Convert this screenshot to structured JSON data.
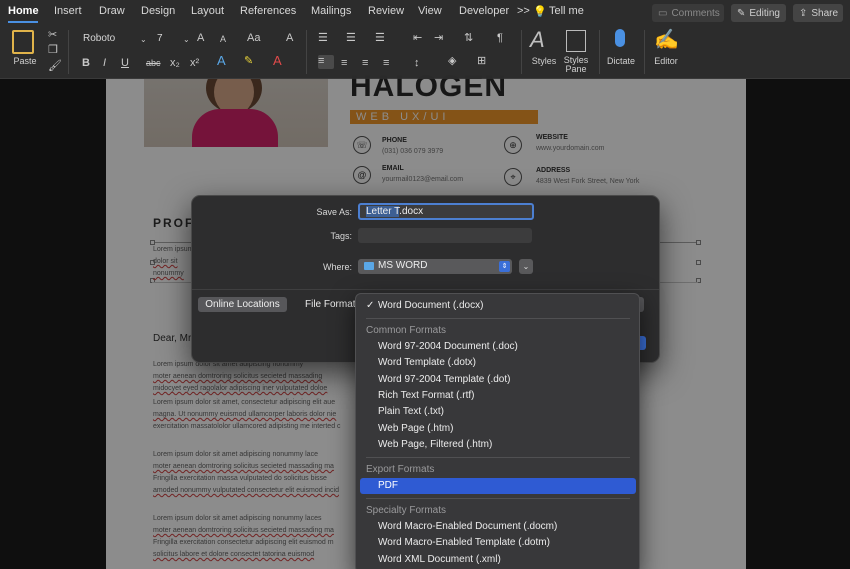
{
  "ribbon": {
    "tabs": [
      "Home",
      "Insert",
      "Draw",
      "Design",
      "Layout",
      "References",
      "Mailings",
      "Review",
      "View",
      "Developer"
    ],
    "more_glyph": ">>",
    "tell_me": "Tell me",
    "comments": "Comments",
    "editing": "Editing",
    "share": "Share",
    "paste_label": "Paste",
    "font_name": "Roboto",
    "font_size": "7",
    "styles_label": "Styles",
    "styles_pane_label": "Styles Pane",
    "dictate_label": "Dictate",
    "editor_label": "Editor",
    "bold": "B",
    "italic": "I",
    "underline": "U",
    "strike": "abc",
    "subscript": "x₂",
    "superscript": "x²",
    "grow_font": "A",
    "shrink_font": "A",
    "change_case": "Aa",
    "clear_format": "A",
    "pilcrow": "¶"
  },
  "document": {
    "name": "HALOGEN",
    "role": "WEB UX/UI DESIGNER",
    "contacts": [
      {
        "label": "PHONE",
        "value": "(031) 036 079 3979"
      },
      {
        "label": "WEBSITE",
        "value": "www.yourdomain.com"
      },
      {
        "label": "EMAIL",
        "value": "yourmail0123@email.com"
      },
      {
        "label": "ADDRESS",
        "value": "4839 West Fork Street, New York"
      }
    ],
    "profile_heading": "PROF",
    "profile_lines": [
      "Lorem ipsum",
      "dolor sit",
      "nonummy"
    ],
    "greeting": "Dear, Mr",
    "paragraph1": [
      "Lorem ipsum dolor sit amet adipiscing nonummy",
      "moter aenean domtroring solicitus secieted massading",
      "midocyet eyed ragolalor adipiscing iner vulputated doloe"
    ],
    "paragraph2": [
      "Lorem ipsum dolor sit amet, consectetur adipiscing elit aue",
      "magna. Ut nonummy euismod ullamcorper laboris dolor nie",
      "exercitation massatololor ullamcored adipisting me interted c"
    ],
    "paragraph3": [
      "Lorem ipsum dolor sit amet adipiscing nonummy lace",
      "moter aenean domtroring solicitus secieted massading ma",
      "Fringilla exercitation massa vulputated do solicitus bisse",
      "amoded nonummy vulputated consectetur elit euismod incid"
    ],
    "paragraph4": [
      "Lorem ipsum dolor sit amet adipiscing nonummy laces",
      "moter aenean domtroring solicitus secieted massading ma",
      "Fringilla exercitation consectetur adipiscing elit euismod m",
      "solicitus labore et dolore consectet tatorina euismod"
    ]
  },
  "save_dialog": {
    "save_as_label": "Save As:",
    "filename_selected": "Letter T",
    "filename_ext": ".docx",
    "tags_label": "Tags:",
    "tags_value": "",
    "where_label": "Where:",
    "where_value": "MS WORD",
    "online_locations": "Online Locations",
    "file_format_label": "File Format"
  },
  "format_menu": {
    "selected": "Word Document (.docx)",
    "common_header": "Common Formats",
    "common": [
      "Word 97-2004 Document (.doc)",
      "Word Template (.dotx)",
      "Word 97-2004 Template (.dot)",
      "Rich Text Format (.rtf)",
      "Plain Text (.txt)",
      "Web Page (.htm)",
      "Web Page, Filtered (.htm)"
    ],
    "export_header": "Export Formats",
    "export": [
      "PDF"
    ],
    "specialty_header": "Specialty Formats",
    "specialty": [
      "Word Macro-Enabled Document (.docm)",
      "Word Macro-Enabled Template (.dotm)",
      "Word XML Document (.xml)"
    ]
  },
  "colors": {
    "accent": "#2f5bd3",
    "role_bar": "#f0972a",
    "jacket": "#d6246a"
  }
}
